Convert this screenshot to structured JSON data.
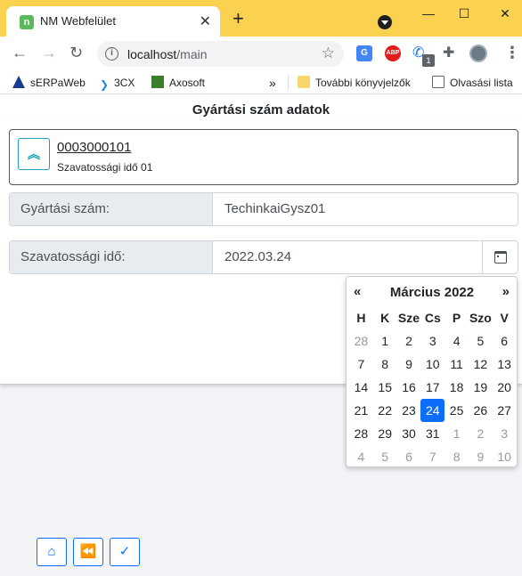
{
  "browser": {
    "tab_title": "NM Webfelület",
    "tab_favicon": "n",
    "url_host": "localhost",
    "url_path": "/main",
    "ext_badge": "1",
    "abp_label": "ABP",
    "translate_label": "G"
  },
  "bookmarks": [
    {
      "label": "sERPaWeb",
      "icon": "serpa-icon"
    },
    {
      "label": "3CX",
      "icon": "3cx-icon"
    },
    {
      "label": "Axosoft",
      "icon": "axosoft-icon"
    },
    {
      "label": "»",
      "icon": ""
    },
    {
      "label": "További könyvjelzők",
      "icon": "folder-icon"
    },
    {
      "label": "Olvasási lista",
      "icon": "reading-list-icon"
    }
  ],
  "page": {
    "title": "Gyártási szám adatok",
    "item": {
      "number": "0003000101",
      "subtitle": "Szavatossági idő 01"
    },
    "fields": [
      {
        "label": "Gyártási szám:",
        "value": "TechinkaiGysz01"
      },
      {
        "label": "Szavatossági idő:",
        "value": "2022.03.24"
      }
    ]
  },
  "calendar": {
    "prev": "«",
    "next": "»",
    "month": "Március 2022",
    "weekdays": [
      "H",
      "K",
      "Sze",
      "Cs",
      "P",
      "Szo",
      "V"
    ],
    "weeks": [
      [
        "28",
        "1",
        "2",
        "3",
        "4",
        "5",
        "6"
      ],
      [
        "7",
        "8",
        "9",
        "10",
        "11",
        "12",
        "13"
      ],
      [
        "14",
        "15",
        "16",
        "17",
        "18",
        "19",
        "20"
      ],
      [
        "21",
        "22",
        "23",
        "24",
        "25",
        "26",
        "27"
      ],
      [
        "28",
        "29",
        "30",
        "31",
        "1",
        "2",
        "3"
      ],
      [
        "4",
        "5",
        "6",
        "7",
        "8",
        "9",
        "10"
      ]
    ],
    "selected_day": "24"
  },
  "colors": {
    "accent": "#0d6efd",
    "info": "#17a2b8",
    "titlebar": "#fad250"
  }
}
